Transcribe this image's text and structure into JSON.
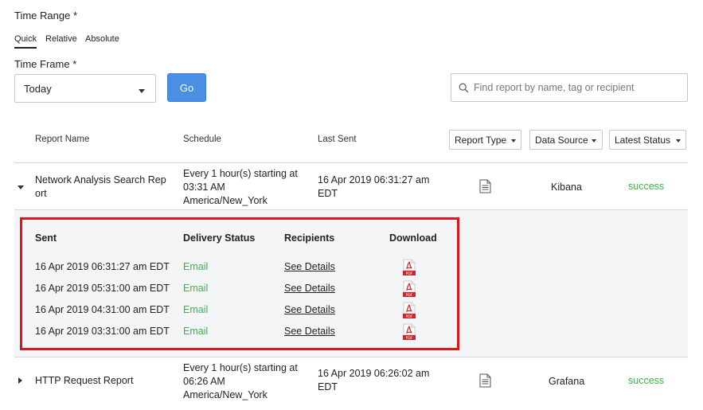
{
  "time_range": {
    "label": "Time Range *",
    "tabs": [
      {
        "label": "Quick",
        "active": true
      },
      {
        "label": "Relative",
        "active": false
      },
      {
        "label": "Absolute",
        "active": false
      }
    ]
  },
  "time_frame": {
    "label": "Time Frame *",
    "selected": "Today",
    "go_label": "Go"
  },
  "search": {
    "placeholder": "Find report by name, tag or recipient"
  },
  "table": {
    "headers": {
      "report_name": "Report Name",
      "schedule": "Schedule",
      "last_sent": "Last Sent"
    },
    "filters": {
      "report_type": "Report Type",
      "data_source": "Data Source",
      "latest_status": "Latest Status"
    },
    "rows": [
      {
        "name_line1": "Network Analysis Search Rep",
        "name_line2": "ort",
        "schedule_line1": "Every 1 hour(s) starting at",
        "schedule_line2": "03:31 AM",
        "schedule_line3": "America/New_York",
        "last_sent_line1": "16 Apr 2019 06:31:27 am",
        "last_sent_line2": "EDT",
        "data_source": "Kibana",
        "status": "success",
        "expanded": true
      },
      {
        "name_line1": "HTTP Request Report",
        "schedule_line1": "Every 1 hour(s) starting at",
        "schedule_line2": "06:26 AM",
        "schedule_line3": "America/New_York",
        "last_sent_line1": "16 Apr 2019 06:26:02 am",
        "last_sent_line2": "EDT",
        "data_source": "Grafana",
        "status": "success",
        "expanded": false
      }
    ]
  },
  "history": {
    "headers": {
      "sent": "Sent",
      "delivery_status": "Delivery Status",
      "recipients": "Recipients",
      "download": "Download"
    },
    "rows": [
      {
        "sent": "16 Apr 2019 06:31:27 am EDT",
        "delivery": "Email",
        "recipients": "See Details",
        "download": "PDF"
      },
      {
        "sent": "16 Apr 2019 05:31:00 am EDT",
        "delivery": "Email",
        "recipients": "See Details",
        "download": "PDF"
      },
      {
        "sent": "16 Apr 2019 04:31:00 am EDT",
        "delivery": "Email",
        "recipients": "See Details",
        "download": "PDF"
      },
      {
        "sent": "16 Apr 2019 03:31:00 am EDT",
        "delivery": "Email",
        "recipients": "See Details",
        "download": "PDF"
      }
    ]
  },
  "colors": {
    "accent": "#4a8fe4",
    "success": "#3db34a",
    "highlight": "#e3121b"
  }
}
